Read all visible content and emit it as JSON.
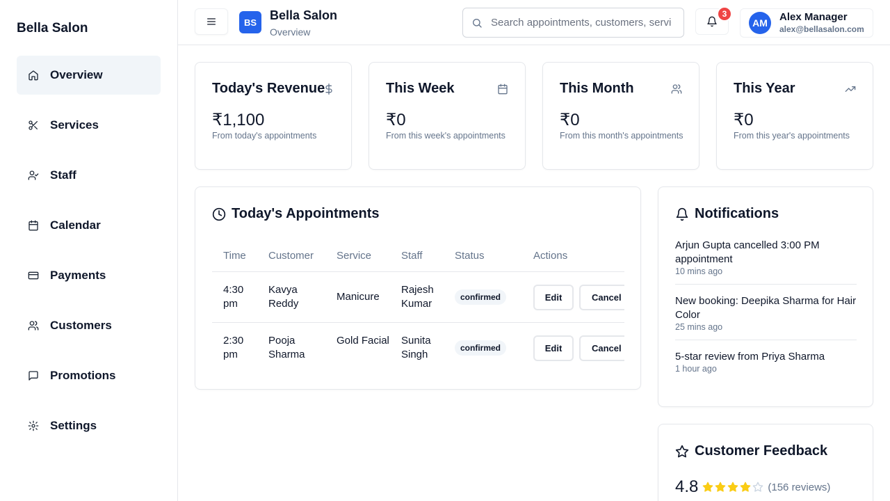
{
  "sidebar": {
    "brand": "Bella Salon",
    "items": [
      {
        "label": "Overview",
        "icon": "home-icon",
        "active": true
      },
      {
        "label": "Services",
        "icon": "scissors-icon"
      },
      {
        "label": "Staff",
        "icon": "user-check-icon"
      },
      {
        "label": "Calendar",
        "icon": "calendar-icon"
      },
      {
        "label": "Payments",
        "icon": "credit-card-icon"
      },
      {
        "label": "Customers",
        "icon": "users-icon"
      },
      {
        "label": "Promotions",
        "icon": "message-square-icon"
      },
      {
        "label": "Settings",
        "icon": "gear-icon"
      }
    ]
  },
  "header": {
    "logo_initials": "BS",
    "title": "Bella Salon",
    "subtitle": "Overview",
    "search_placeholder": "Search appointments, customers, services...",
    "notification_count": "3",
    "user": {
      "initials": "AM",
      "name": "Alex Manager",
      "email": "alex@bellasalon.com"
    }
  },
  "stats": [
    {
      "title": "Today's Revenue",
      "value": "₹1,100",
      "desc": "From today's appointments",
      "icon": "dollar-icon"
    },
    {
      "title": "This Week",
      "value": "₹0",
      "desc": "From this week's appointments",
      "icon": "calendar-icon"
    },
    {
      "title": "This Month",
      "value": "₹0",
      "desc": "From this month's appointments",
      "icon": "users-icon"
    },
    {
      "title": "This Year",
      "value": "₹0",
      "desc": "From this year's appointments",
      "icon": "trending-up-icon"
    }
  ],
  "appointments": {
    "title": "Today's Appointments",
    "columns": [
      "Time",
      "Customer",
      "Service",
      "Staff",
      "Status",
      "Actions"
    ],
    "rows": [
      {
        "time": "4:30 pm",
        "customer": "Kavya Reddy",
        "service": "Manicure",
        "staff": "Rajesh Kumar",
        "status": "confirmed"
      },
      {
        "time": "2:30 pm",
        "customer": "Pooja Sharma",
        "service": "Gold Facial",
        "staff": "Sunita Singh",
        "status": "confirmed"
      }
    ],
    "edit_label": "Edit",
    "cancel_label": "Cancel"
  },
  "notifications": {
    "title": "Notifications",
    "items": [
      {
        "text": "Arjun Gupta cancelled 3:00 PM appointment",
        "time": "10 mins ago"
      },
      {
        "text": "New booking: Deepika Sharma for Hair Color",
        "time": "25 mins ago"
      },
      {
        "text": "5-star review from Priya Sharma",
        "time": "1 hour ago"
      }
    ]
  },
  "feedback": {
    "title": "Customer Feedback",
    "score": "4.8",
    "stars_filled": 4,
    "stars_total": 5,
    "reviews": "(156 reviews)",
    "star_color": "#facc15"
  }
}
